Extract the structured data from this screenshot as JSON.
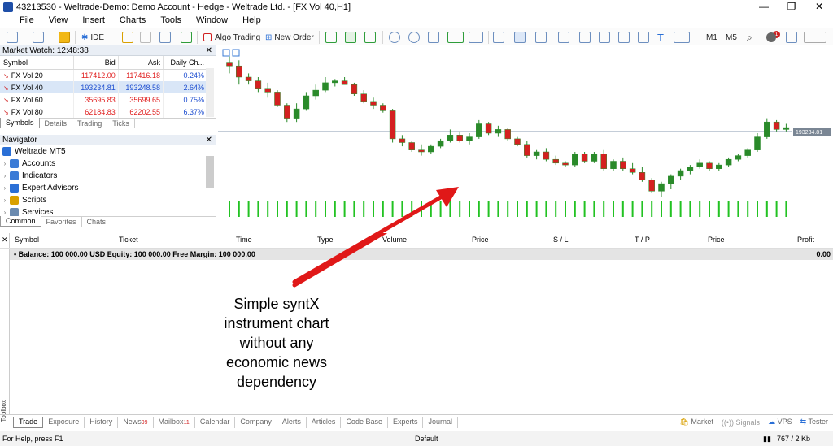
{
  "window": {
    "title": "43213530 - Weltrade-Demo: Demo Account - Hedge - Weltrade Ltd. - [FX Vol 40,H1]",
    "min": "—",
    "restore": "❐",
    "close": "✕"
  },
  "menu": [
    "File",
    "View",
    "Insert",
    "Charts",
    "Tools",
    "Window",
    "Help"
  ],
  "toolbar": {
    "algo": "Algo Trading",
    "neworder": "New Order",
    "ide": "IDE",
    "m1": "M1",
    "m5": "M5",
    "notif": "1"
  },
  "marketwatch": {
    "title": "Market Watch: 12:48:38",
    "cols": [
      "Symbol",
      "Bid",
      "Ask",
      "Daily Ch..."
    ],
    "rows": [
      {
        "sym": "FX Vol 20",
        "bid": "117412.00",
        "ask": "117416.18",
        "chg": "0.24%"
      },
      {
        "sym": "FX Vol 40",
        "bid": "193234.81",
        "ask": "193248.58",
        "chg": "2.64%"
      },
      {
        "sym": "FX Vol 60",
        "bid": "35695.83",
        "ask": "35699.65",
        "chg": "0.75%"
      },
      {
        "sym": "FX Vol 80",
        "bid": "62184.83",
        "ask": "62202.55",
        "chg": "6.37%"
      }
    ],
    "tabs": [
      "Symbols",
      "Details",
      "Trading",
      "Ticks"
    ]
  },
  "navigator": {
    "title": "Navigator",
    "root": "Weltrade MT5",
    "items": [
      "Accounts",
      "Indicators",
      "Expert Advisors",
      "Scripts",
      "Services"
    ],
    "tabs": [
      "Common",
      "Favorites",
      "Chats"
    ]
  },
  "chart": {
    "price_label": "193234.81",
    "candles": [
      [
        3.8,
        4.2,
        3.2,
        3.6
      ],
      [
        3.6,
        3.9,
        2.6,
        3.0
      ],
      [
        3.0,
        3.2,
        2.6,
        2.8
      ],
      [
        2.8,
        3.0,
        2.2,
        2.4
      ],
      [
        2.4,
        2.7,
        1.9,
        2.2
      ],
      [
        2.2,
        2.3,
        1.4,
        1.5
      ],
      [
        1.5,
        1.6,
        0.6,
        0.8
      ],
      [
        0.8,
        1.6,
        0.6,
        1.3
      ],
      [
        1.3,
        2.2,
        1.2,
        2.0
      ],
      [
        2.0,
        2.6,
        1.8,
        2.3
      ],
      [
        2.3,
        3.0,
        2.2,
        2.7
      ],
      [
        2.7,
        2.9,
        2.5,
        2.8
      ],
      [
        2.8,
        3.0,
        2.6,
        2.6
      ],
      [
        2.6,
        2.7,
        2.0,
        2.1
      ],
      [
        2.1,
        2.3,
        1.6,
        1.7
      ],
      [
        1.7,
        1.9,
        1.3,
        1.5
      ],
      [
        1.5,
        1.6,
        1.1,
        1.2
      ],
      [
        1.2,
        1.3,
        -0.5,
        -0.3
      ],
      [
        -0.3,
        -0.1,
        -0.7,
        -0.5
      ],
      [
        -0.5,
        -0.4,
        -1.0,
        -0.9
      ],
      [
        -0.9,
        -0.6,
        -1.2,
        -1.0
      ],
      [
        -1.0,
        -0.6,
        -1.1,
        -0.7
      ],
      [
        -0.7,
        -0.3,
        -0.8,
        -0.4
      ],
      [
        -0.4,
        0.2,
        -0.5,
        -0.1
      ],
      [
        -0.1,
        0.1,
        -0.5,
        -0.4
      ],
      [
        -0.4,
        0.0,
        -0.6,
        -0.2
      ],
      [
        -0.2,
        0.7,
        -0.3,
        0.5
      ],
      [
        0.5,
        0.6,
        -0.1,
        0.0
      ],
      [
        0.0,
        0.4,
        -0.2,
        0.2
      ],
      [
        0.2,
        0.3,
        -0.4,
        -0.3
      ],
      [
        -0.3,
        -0.2,
        -0.7,
        -0.6
      ],
      [
        -0.6,
        -0.4,
        -1.3,
        -1.2
      ],
      [
        -1.2,
        -0.9,
        -1.4,
        -1.0
      ],
      [
        -1.0,
        -0.8,
        -1.5,
        -1.4
      ],
      [
        -1.4,
        -1.2,
        -1.7,
        -1.6
      ],
      [
        -1.6,
        -1.5,
        -1.8,
        -1.7
      ],
      [
        -1.7,
        -1.0,
        -1.8,
        -1.1
      ],
      [
        -1.1,
        -1.0,
        -1.6,
        -1.5
      ],
      [
        -1.5,
        -1.0,
        -1.6,
        -1.1
      ],
      [
        -1.1,
        -0.9,
        -2.0,
        -1.9
      ],
      [
        -1.9,
        -1.4,
        -2.0,
        -1.5
      ],
      [
        -1.5,
        -1.3,
        -2.0,
        -1.9
      ],
      [
        -1.9,
        -1.6,
        -2.2,
        -2.1
      ],
      [
        -2.1,
        -1.8,
        -2.6,
        -2.5
      ],
      [
        -2.5,
        -2.4,
        -3.2,
        -3.1
      ],
      [
        -3.1,
        -2.6,
        -3.4,
        -2.7
      ],
      [
        -2.7,
        -2.2,
        -3.0,
        -2.3
      ],
      [
        -2.3,
        -1.9,
        -2.5,
        -2.0
      ],
      [
        -2.0,
        -1.7,
        -2.2,
        -1.8
      ],
      [
        -1.8,
        -1.4,
        -1.9,
        -1.6
      ],
      [
        -1.6,
        -1.5,
        -2.0,
        -1.9
      ],
      [
        -1.9,
        -1.6,
        -2.0,
        -1.7
      ],
      [
        -1.7,
        -1.3,
        -1.8,
        -1.4
      ],
      [
        -1.4,
        -1.1,
        -1.5,
        -1.2
      ],
      [
        -1.2,
        -0.8,
        -1.3,
        -0.9
      ],
      [
        -0.9,
        0.0,
        -1.0,
        -0.2
      ],
      [
        -0.2,
        0.8,
        -0.3,
        0.6
      ],
      [
        0.6,
        0.7,
        0.1,
        0.2
      ],
      [
        0.2,
        0.5,
        0.1,
        0.3
      ]
    ]
  },
  "trade": {
    "cols": [
      "Symbol",
      "Ticket",
      "Time",
      "Type",
      "Volume",
      "Price",
      "S / L",
      "T / P",
      "Price",
      "Profit"
    ],
    "balance": "Balance: 100 000.00 USD  Equity: 100 000.00  Free Margin: 100 000.00",
    "profit": "0.00",
    "toolbox": "Toolbox"
  },
  "annotation": [
    "Simple syntX",
    "instrument chart",
    "without any",
    "economic news",
    "dependency"
  ],
  "bottomtabs": [
    {
      "label": "Trade",
      "badge": ""
    },
    {
      "label": "Exposure",
      "badge": ""
    },
    {
      "label": "History",
      "badge": ""
    },
    {
      "label": "News",
      "badge": "99"
    },
    {
      "label": "Mailbox",
      "badge": "11"
    },
    {
      "label": "Calendar",
      "badge": ""
    },
    {
      "label": "Company",
      "badge": ""
    },
    {
      "label": "Alerts",
      "badge": ""
    },
    {
      "label": "Articles",
      "badge": ""
    },
    {
      "label": "Code Base",
      "badge": ""
    },
    {
      "label": "Experts",
      "badge": ""
    },
    {
      "label": "Journal",
      "badge": ""
    }
  ],
  "bottomright": {
    "market": "Market",
    "signals": "Signals",
    "vps": "VPS",
    "tester": "Tester"
  },
  "status": {
    "help": "For Help, press F1",
    "profile": "Default",
    "traffic": "767 / 2 Kb"
  }
}
